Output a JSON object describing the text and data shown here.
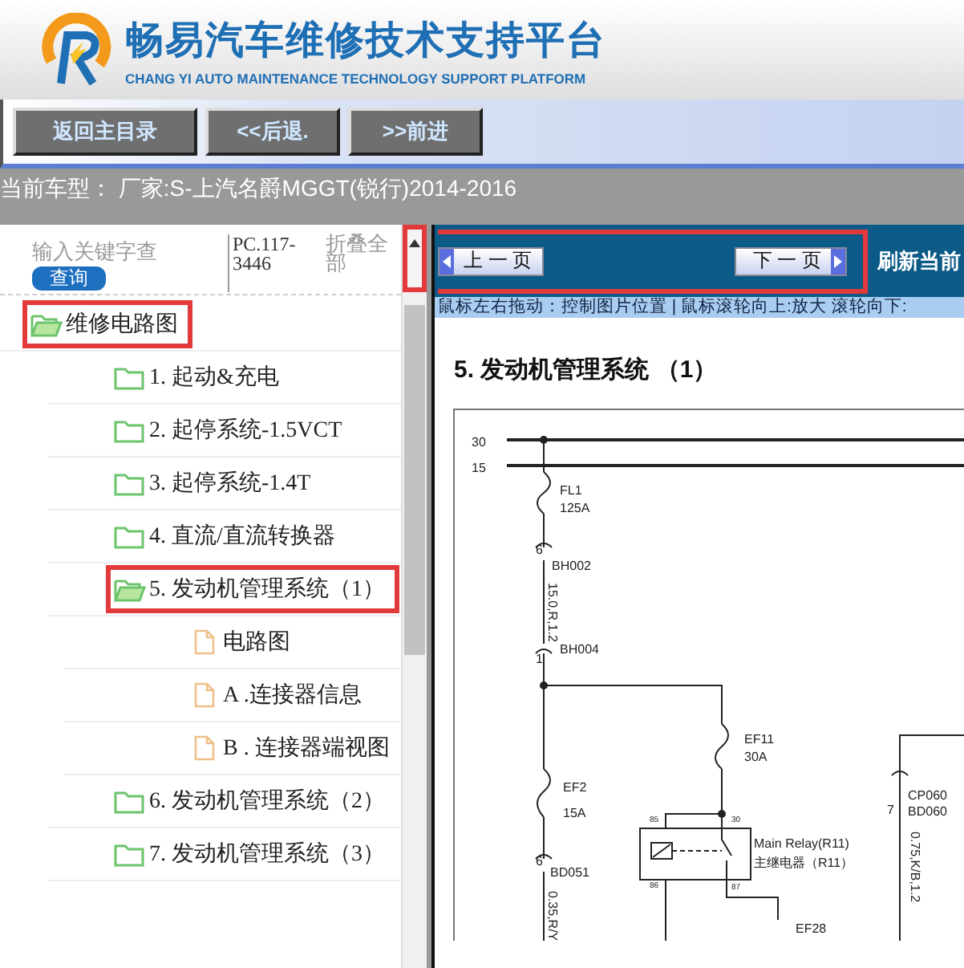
{
  "header": {
    "title": "畅易汽车维修技术支持平台",
    "subtitle": "CHANG YI AUTO MAINTENANCE TECHNOLOGY SUPPORT PLATFORM"
  },
  "nav_buttons": [
    "返回主目录",
    "<<后退.",
    ">>前进"
  ],
  "current_model": "当前车型：  厂家:S-上汽名爵MGGT(锐行)2014-2016",
  "sidebar": {
    "search": {
      "placeholder": "输入关键字查"
    },
    "search_button": "查询",
    "code": "PC.117-3446",
    "collapse_all": "折叠全部",
    "scroll_up_highlighted": true,
    "tree": [
      {
        "label": "维修电路图",
        "kind": "folder",
        "expanded": true,
        "highlighted": true,
        "children": [
          {
            "label": "1. 起动&充电",
            "kind": "folder",
            "expanded": false,
            "highlighted": false
          },
          {
            "label": "2. 起停系统-1.5VCT",
            "kind": "folder",
            "expanded": false,
            "highlighted": false
          },
          {
            "label": "3. 起停系统-1.4T",
            "kind": "folder",
            "expanded": false,
            "highlighted": false
          },
          {
            "label": "4. 直流/直流转换器",
            "kind": "folder",
            "expanded": false,
            "highlighted": false
          },
          {
            "label": "5. 发动机管理系统（1）",
            "kind": "folder",
            "expanded": true,
            "highlighted": true,
            "children": [
              {
                "label": "电路图",
                "kind": "file",
                "highlighted": false
              },
              {
                "label": "A .连接器信息",
                "kind": "file",
                "highlighted": false
              },
              {
                "label": "B . 连接器端视图",
                "kind": "file",
                "highlighted": false
              }
            ]
          },
          {
            "label": "6. 发动机管理系统（2）",
            "kind": "folder",
            "expanded": false,
            "highlighted": false
          },
          {
            "label": "7. 发动机管理系统（3）",
            "kind": "folder",
            "expanded": false,
            "highlighted": false
          }
        ]
      }
    ]
  },
  "viewer": {
    "prev_button": "上 一 页",
    "next_button": "下 一 页",
    "pager_highlighted": true,
    "refresh": "刷新当前",
    "hint": "鼠标左右拖动：控制图片位置 | 鼠标滚轮向上:放大  滚轮向下:",
    "title": "5. 发动机管理系统 （1）",
    "diagram": {
      "labels": [
        "30",
        "15",
        "FL1",
        "125A",
        "6",
        "BH002",
        "15.0,R,1.2",
        "BH004",
        "1",
        "EF11",
        "30A",
        "EF2",
        "15A",
        "85",
        "30",
        "Main Relay(R11)",
        "主继电器（R11）",
        "86",
        "87",
        "6",
        "BD051",
        "0.35,R/Y",
        "EF28",
        "7",
        "CP060",
        "BD060",
        "0.75,K/B,1.2"
      ]
    }
  }
}
